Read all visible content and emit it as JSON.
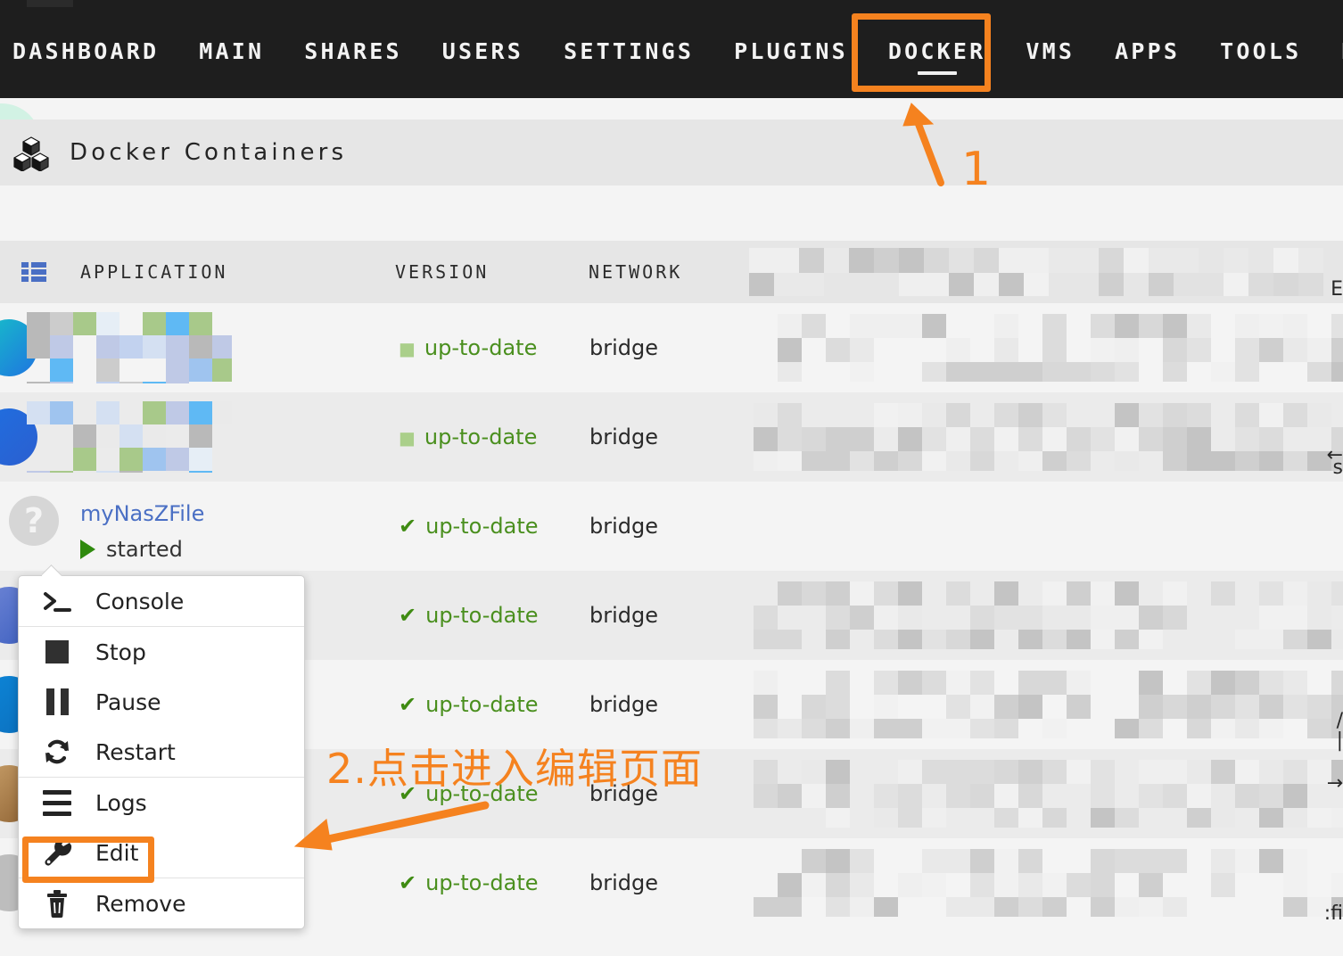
{
  "nav": {
    "items": [
      {
        "label": "DASHBOARD",
        "active": false
      },
      {
        "label": "MAIN",
        "active": false
      },
      {
        "label": "SHARES",
        "active": false
      },
      {
        "label": "USERS",
        "active": false
      },
      {
        "label": "SETTINGS",
        "active": false
      },
      {
        "label": "PLUGINS",
        "active": false
      },
      {
        "label": "DOCKER",
        "active": true
      },
      {
        "label": "VMS",
        "active": false
      },
      {
        "label": "APPS",
        "active": false
      },
      {
        "label": "TOOLS",
        "active": false
      },
      {
        "label": "KO",
        "active": false
      }
    ]
  },
  "page": {
    "title": "Docker Containers",
    "icon": "boxes-icon"
  },
  "table": {
    "view_icon": "grid-view-icon",
    "columns": [
      "APPLICATION",
      "VERSION",
      "NETWORK"
    ],
    "rows": [
      {
        "name": "",
        "state": "",
        "version": "up-to-date",
        "network": "bridge",
        "censored": true,
        "icon": "censored-app-icon"
      },
      {
        "name": "",
        "state": "",
        "version": "up-to-date",
        "network": "bridge",
        "censored": true,
        "icon": "censored-app-icon"
      },
      {
        "name": "myNasZFile",
        "state": "started",
        "version": "up-to-date",
        "network": "bridge",
        "censored": false,
        "icon": "unknown-app-icon"
      },
      {
        "name": "",
        "state": "",
        "version": "up-to-date",
        "network": "bridge",
        "censored": true,
        "icon": "censored-app-icon"
      },
      {
        "name": "",
        "state": "",
        "version": "up-to-date",
        "network": "bridge",
        "censored": true,
        "icon": "censored-app-icon"
      },
      {
        "name": "",
        "state": "",
        "version": "up-to-date",
        "network": "bridge",
        "censored": true,
        "icon": "censored-app-icon"
      },
      {
        "name": "",
        "state": "",
        "version": "up-to-date",
        "network": "bridge",
        "censored": true,
        "icon": "censored-app-icon"
      }
    ],
    "edge_fragments": [
      "E",
      "←",
      "s",
      "/",
      "|",
      "→",
      ":fi"
    ]
  },
  "context_menu": {
    "items": [
      {
        "label": "Console",
        "icon": "terminal-prompt-icon",
        "separator_above": false
      },
      {
        "label": "Stop",
        "icon": "stop-square-icon",
        "separator_above": true
      },
      {
        "label": "Pause",
        "icon": "pause-bars-icon",
        "separator_above": false
      },
      {
        "label": "Restart",
        "icon": "restart-arrows-icon",
        "separator_above": false
      },
      {
        "label": "Logs",
        "icon": "logs-lines-icon",
        "separator_above": true
      },
      {
        "label": "Edit",
        "icon": "wrench-icon",
        "separator_above": false
      },
      {
        "label": "Remove",
        "icon": "trash-icon",
        "separator_above": true
      }
    ]
  },
  "annotations": {
    "color": "#f5821f",
    "step1_number": "1",
    "step2_text": "2.点击进入编辑页面",
    "docker_highlight": "DOCKER",
    "edit_highlight": "Edit"
  },
  "colors": {
    "accent_orange": "#f5821f",
    "nav_bg": "#1e1e1e",
    "header_band": "#e6e6e6",
    "row_odd": "#f4f4f4",
    "row_even": "#ebebeb",
    "status_green": "#4a8f1e",
    "link_blue": "#4a6fc4",
    "mint_circle": "#d2f2e4"
  }
}
